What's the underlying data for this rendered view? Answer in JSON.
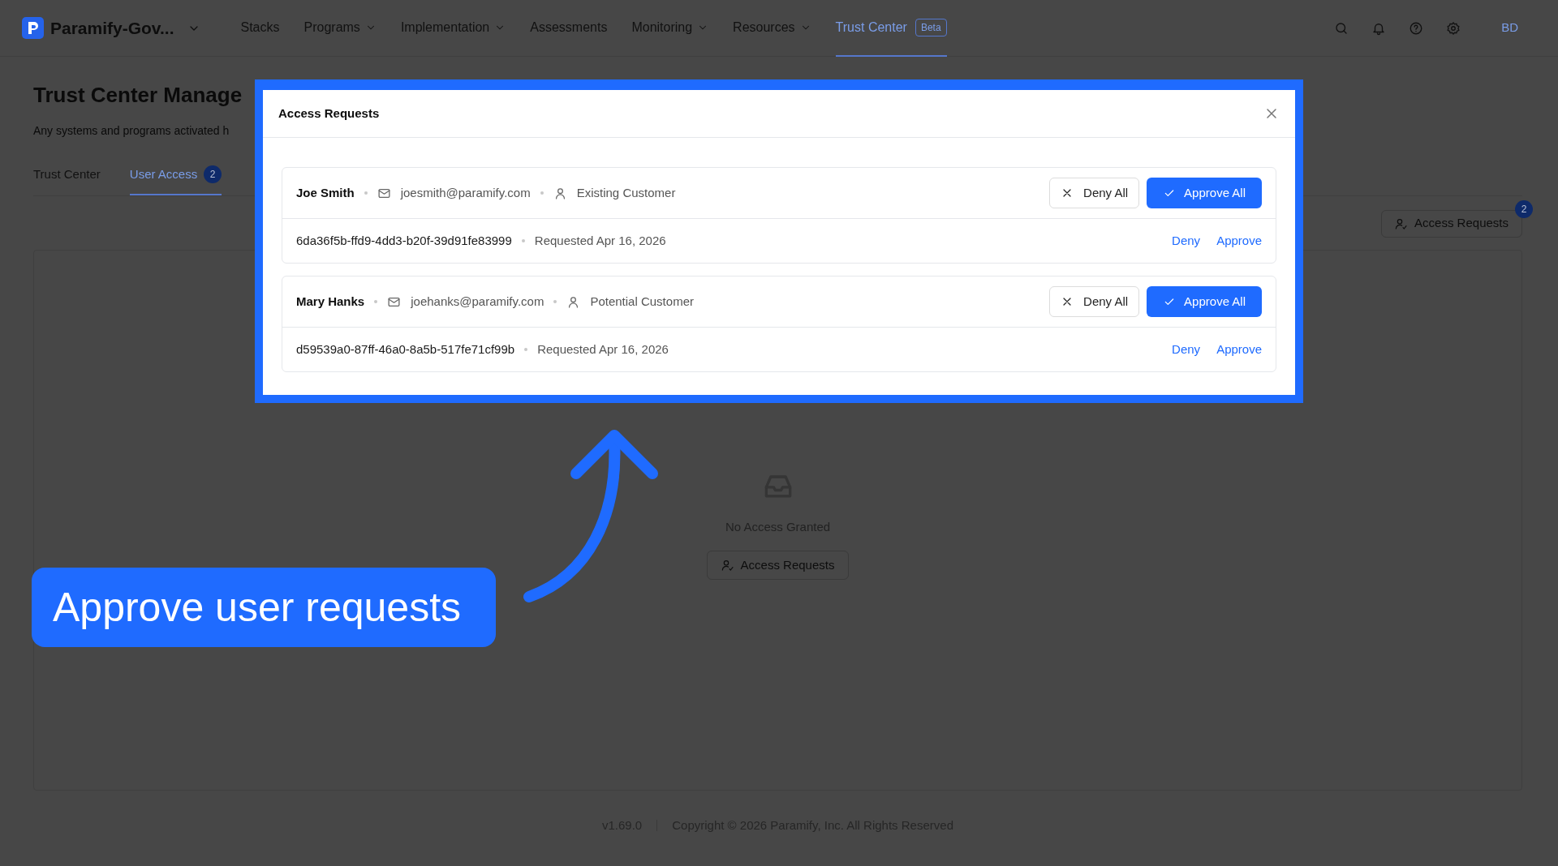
{
  "nav": {
    "brand": "Paramify-Gov...",
    "items": [
      {
        "label": "Stacks",
        "dropdown": false,
        "selected": false
      },
      {
        "label": "Programs",
        "dropdown": true,
        "selected": false
      },
      {
        "label": "Implementation",
        "dropdown": true,
        "selected": false
      },
      {
        "label": "Assessments",
        "dropdown": false,
        "selected": false
      },
      {
        "label": "Monitoring",
        "dropdown": true,
        "selected": false
      },
      {
        "label": "Resources",
        "dropdown": true,
        "selected": false
      },
      {
        "label": "Trust Center",
        "dropdown": false,
        "selected": true,
        "badge": "Beta"
      }
    ],
    "avatar": "BD"
  },
  "page": {
    "title": "Trust Center Manage",
    "subtitle": "Any systems and programs activated h",
    "tabs": [
      {
        "label": "Trust Center",
        "selected": false
      },
      {
        "label": "User Access",
        "selected": true,
        "count": "2"
      }
    ],
    "access_requests_button": {
      "label": "Access Requests",
      "count": "2"
    },
    "empty_state": {
      "message": "No Access Granted",
      "button": "Access Requests"
    }
  },
  "footer": {
    "version": "v1.69.0",
    "copyright": "Copyright © 2026 Paramify, Inc. All Rights Reserved"
  },
  "modal": {
    "title": "Access Requests",
    "requests": [
      {
        "name": "Joe Smith",
        "email": "joesmith@paramify.com",
        "customer_type": "Existing Customer",
        "deny_all": "Deny All",
        "approve_all": "Approve All",
        "items": [
          {
            "id": "6da36f5b-ffd9-4dd3-b20f-39d91fe83999",
            "requested": "Requested Apr 16, 2026",
            "deny": "Deny",
            "approve": "Approve"
          }
        ]
      },
      {
        "name": "Mary Hanks",
        "email": "joehanks@paramify.com",
        "customer_type": "Potential Customer",
        "deny_all": "Deny All",
        "approve_all": "Approve All",
        "items": [
          {
            "id": "d59539a0-87ff-46a0-8a5b-517fe71cf99b",
            "requested": "Requested Apr 16, 2026",
            "deny": "Deny",
            "approve": "Approve"
          }
        ]
      }
    ]
  },
  "callout": {
    "text": "Approve user requests"
  }
}
